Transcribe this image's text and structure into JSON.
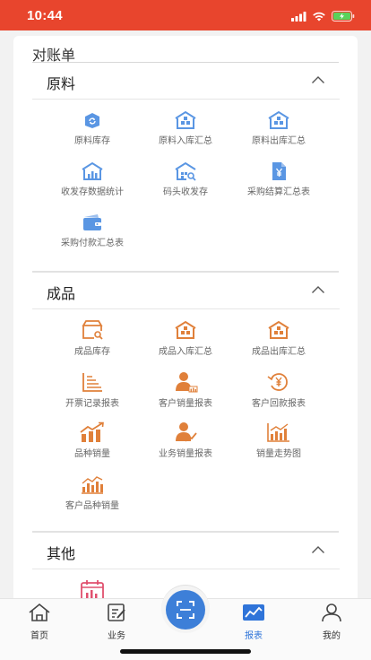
{
  "status_bar": {
    "time": "10:44"
  },
  "page_title": "对账单",
  "sections": [
    {
      "title": "原料",
      "items": [
        {
          "label": "原料库存",
          "icon": "recycle-box-icon"
        },
        {
          "label": "原料入库汇总",
          "icon": "warehouse-in-icon"
        },
        {
          "label": "原料出库汇总",
          "icon": "warehouse-out-icon"
        },
        {
          "label": "收发存数据统计",
          "icon": "warehouse-stats-icon"
        },
        {
          "label": "码头收发存",
          "icon": "dock-warehouse-icon"
        },
        {
          "label": "采购结算汇总表",
          "icon": "yen-document-icon"
        },
        {
          "label": "采购付款汇总表",
          "icon": "wallet-icon"
        }
      ]
    },
    {
      "title": "成品",
      "items": [
        {
          "label": "成品库存",
          "icon": "box-search-icon"
        },
        {
          "label": "成品入库汇总",
          "icon": "warehouse-in-icon"
        },
        {
          "label": "成品出库汇总",
          "icon": "warehouse-out-icon"
        },
        {
          "label": "开票记录报表",
          "icon": "list-lines-icon"
        },
        {
          "label": "客户销量报表",
          "icon": "person-chart-icon"
        },
        {
          "label": "客户回款报表",
          "icon": "yen-refund-icon"
        },
        {
          "label": "品种销量",
          "icon": "bar-trend-icon"
        },
        {
          "label": "业务销量报表",
          "icon": "person-trend-icon"
        },
        {
          "label": "销量走势图",
          "icon": "bar-line-icon"
        },
        {
          "label": "客户品种销量",
          "icon": "bar-line-2-icon"
        }
      ]
    },
    {
      "title": "其他",
      "items": [
        {
          "label": "",
          "icon": "calendar-chart-icon"
        }
      ]
    }
  ],
  "tabbar": {
    "items": [
      {
        "label": "首页",
        "icon": "home-icon"
      },
      {
        "label": "业务",
        "icon": "edit-doc-icon"
      },
      {
        "label": "报表",
        "icon": "chart-icon"
      },
      {
        "label": "我的",
        "icon": "person-icon"
      }
    ],
    "active": "报表",
    "scan_icon": "scan-icon"
  },
  "colors": {
    "status_bar": "#e8452d",
    "raw_material_icon": "#5a96e3",
    "product_icon": "#e0803a",
    "other_icon": "#e0506e",
    "active_tab": "#2f74d9"
  }
}
